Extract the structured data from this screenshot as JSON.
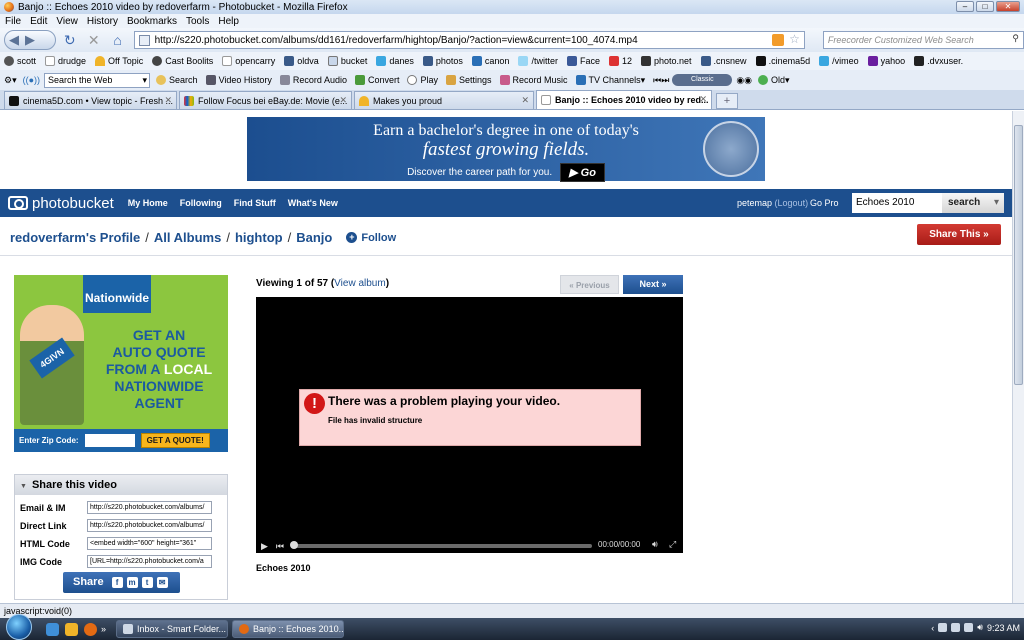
{
  "window": {
    "title": "Banjo :: Echoes 2010 video by redoverfarm - Photobucket - Mozilla Firefox",
    "menu": [
      "File",
      "Edit",
      "View",
      "History",
      "Bookmarks",
      "Tools",
      "Help"
    ]
  },
  "nav": {
    "url": "http://s220.photobucket.com/albums/dd161/redoverfarm/hightop/Banjo/?action=view&current=100_4074.mp4",
    "search_placeholder": "Freecorder Customized Web Search"
  },
  "bookmarks": [
    "scott",
    "drudge",
    "Off Topic",
    "Cast Boolits",
    "opencarry",
    "oldva",
    "bucket",
    "danes",
    "photos",
    "canon",
    "/twitter",
    "Face",
    "12",
    "photo.net",
    ".cnsnew",
    ".cinema5d",
    "/vimeo",
    "yahoo",
    ".dvxuser."
  ],
  "toolbar2": {
    "search_web": "Search the Web",
    "items": [
      "Search",
      "Video History",
      "Record Audio",
      "Convert",
      "Play",
      "Settings",
      "Record Music",
      "TV Channels"
    ],
    "classic": "Classic",
    "old": "Old"
  },
  "tabs": [
    {
      "label": "cinema5D.com • View topic - Fresh ...",
      "active": false
    },
    {
      "label": "Follow Focus bei eBay.de: Movie (e...",
      "active": false
    },
    {
      "label": "Makes you proud",
      "active": false
    },
    {
      "label": "Banjo :: Echoes 2010 video by red...",
      "active": true
    }
  ],
  "top_ad": {
    "line1": "Earn a bachelor's degree in one of today's",
    "line2": "fastest growing fields.",
    "line3": "Discover the career path for you.",
    "go": "Go"
  },
  "pb_nav": {
    "logo": "photobucket",
    "links": [
      "My Home",
      "Following",
      "Find Stuff",
      "What's New"
    ],
    "user": "petemap",
    "logout": "(Logout)",
    "gopro": "Go Pro",
    "search_value": "Echoes 2010",
    "search_btn": "search"
  },
  "breadcrumb": {
    "profile": "redoverfarm's Profile",
    "all_albums": "All Albums",
    "album": "hightop",
    "sub": "Banjo",
    "follow": "Follow"
  },
  "share_this": "Share This »",
  "side_ad": {
    "brand": "Nationwide",
    "plate": "4GIVN",
    "l1": "GET AN",
    "l2": "AUTO QUOTE",
    "l3a": "FROM A ",
    "l3b": "LOCAL",
    "l4": "NATIONWIDE",
    "l5": "AGENT",
    "zip_label": "Enter Zip Code:",
    "cta": "GET A QUOTE!"
  },
  "share_panel": {
    "title": "Share this video",
    "rows": [
      {
        "label": "Email & IM",
        "value": "http://s220.photobucket.com/albums/"
      },
      {
        "label": "Direct Link",
        "value": "http://s220.photobucket.com/albums/"
      },
      {
        "label": "HTML Code",
        "value": "<embed width=\"600\" height=\"361\""
      },
      {
        "label": "IMG Code",
        "value": "[URL=http://s220.photobucket.com/a"
      }
    ],
    "share_btn": "Share"
  },
  "viewer": {
    "viewing": "Viewing 1 of 57",
    "view_album": "View album",
    "prev": "« Previous",
    "next": "Next »",
    "error_title": "There was a problem playing your video.",
    "error_detail": "File has invalid structure",
    "time": "00:00/00:00",
    "video_title": "Echoes 2010"
  },
  "status": "javascript:void(0)",
  "taskbar": {
    "tasks": [
      "Inbox - Smart Folder...",
      "Banjo :: Echoes 2010..."
    ],
    "clock": "9:23 AM"
  }
}
